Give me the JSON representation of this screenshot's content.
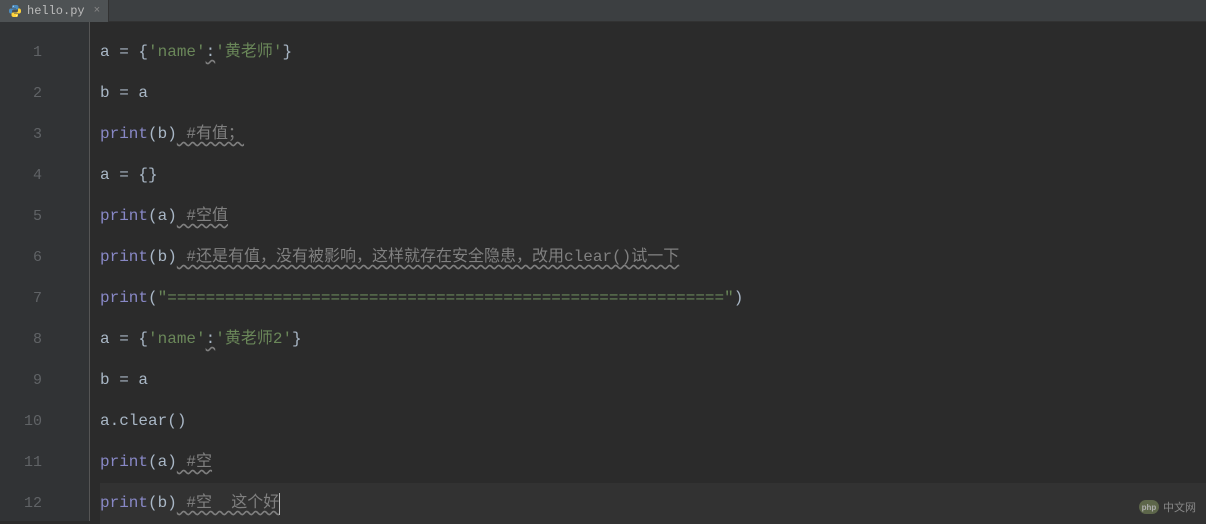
{
  "tab": {
    "filename": "hello.py"
  },
  "gutter": {
    "lines": [
      "1",
      "2",
      "3",
      "4",
      "5",
      "6",
      "7",
      "8",
      "9",
      "10",
      "11",
      "12"
    ]
  },
  "code": {
    "l1": {
      "p1": "a = {",
      "p2": "'name'",
      "p3": ":",
      "p4": "'黄老师'",
      "p5": "}"
    },
    "l2": {
      "p1": "b = a"
    },
    "l3": {
      "p1": "print",
      "p2": "(b)",
      "p3": " #有值；"
    },
    "l4": {
      "p1": "a = {}"
    },
    "l5": {
      "p1": "print",
      "p2": "(a)",
      "p3": " #空值"
    },
    "l6": {
      "p1": "print",
      "p2": "(b)",
      "p3": " #还是有值，没有被影响，这样就存在安全隐患，改用clear()试一下"
    },
    "l7": {
      "p1": "print",
      "p2": "(",
      "p3": "\"==========================================================\"",
      "p4": ")"
    },
    "l8": {
      "p1": "a = {",
      "p2": "'name'",
      "p3": ":",
      "p4": "'黄老师2'",
      "p5": "}"
    },
    "l9": {
      "p1": "b = a"
    },
    "l10": {
      "p1": "a.clear()"
    },
    "l11": {
      "p1": "print",
      "p2": "(a)",
      "p3": " #空"
    },
    "l12": {
      "p1": "print",
      "p2": "(b)",
      "p3": " #空  这个好"
    }
  },
  "watermark": {
    "logo": "php",
    "text": "中文网"
  }
}
